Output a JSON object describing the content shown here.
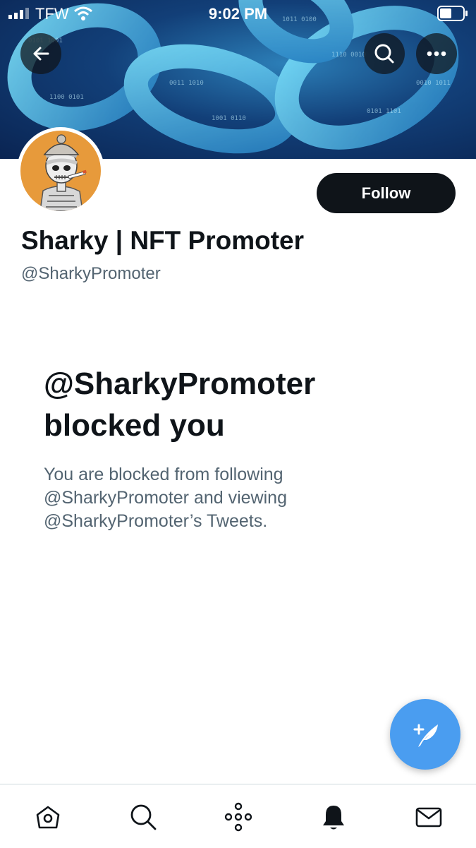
{
  "status_bar": {
    "carrier": "TFW",
    "time": "9:02 PM"
  },
  "header": {
    "back_icon": "arrow-left-icon",
    "search_icon": "search-icon",
    "more_icon": "more-horizontal-icon"
  },
  "profile": {
    "display_name": "Sharky | NFT Promoter",
    "handle": "@SharkyPromoter",
    "follow_label": "Follow",
    "avatar_bg": "#e79a3b"
  },
  "blocked": {
    "title_line1": "@SharkyPromoter",
    "title_line2": "blocked you",
    "description": "You are blocked from following @SharkyPromoter and viewing @SharkyPromoter’s Tweets."
  },
  "compose": {
    "icon": "compose-tweet-icon",
    "color": "#4a9df0"
  },
  "tabs": [
    {
      "name": "home",
      "icon": "home-icon"
    },
    {
      "name": "search",
      "icon": "search-icon"
    },
    {
      "name": "spaces",
      "icon": "spaces-icon"
    },
    {
      "name": "notifications",
      "icon": "bell-icon"
    },
    {
      "name": "messages",
      "icon": "mail-icon"
    }
  ]
}
